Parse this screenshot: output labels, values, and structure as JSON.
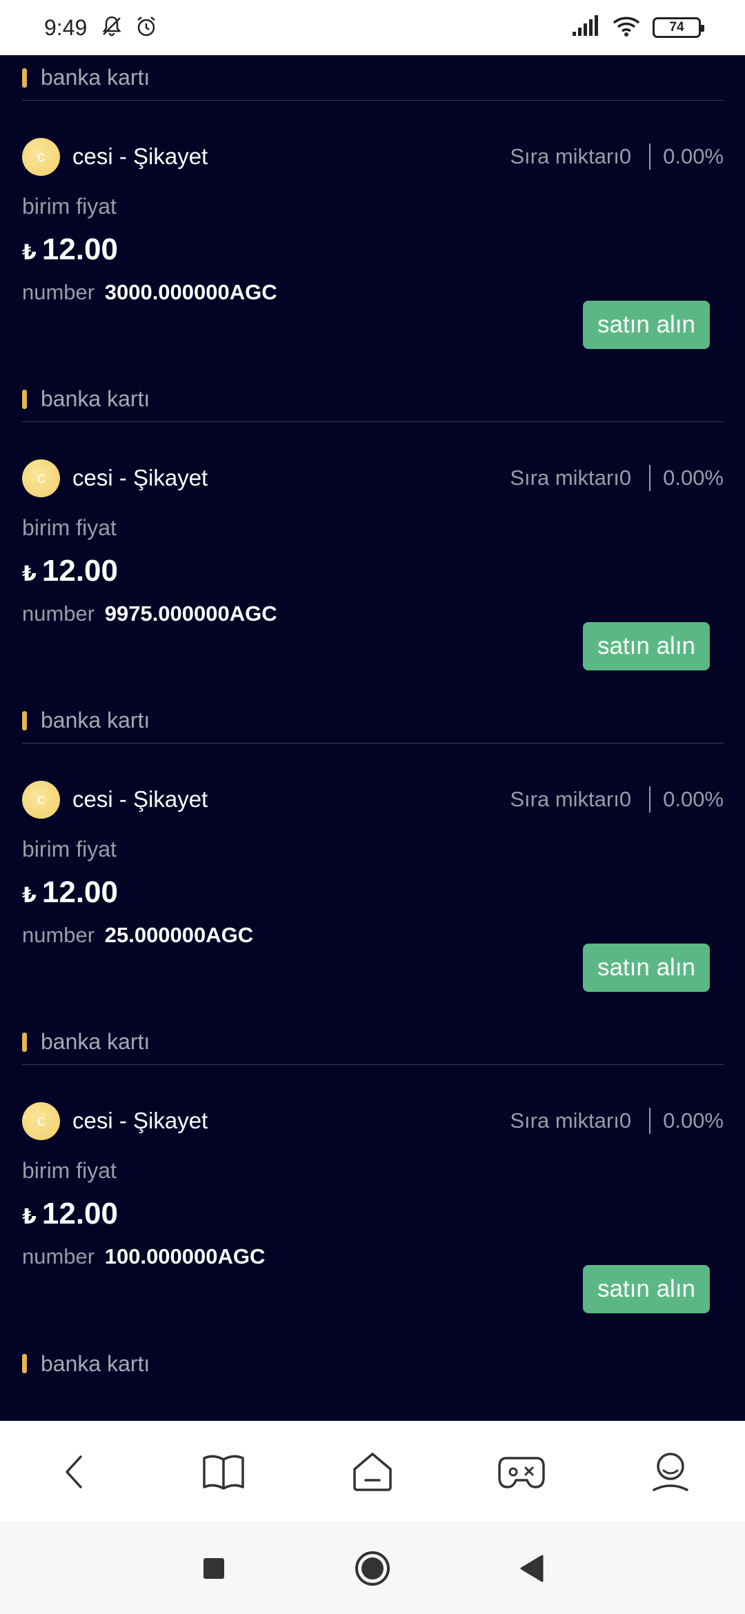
{
  "status_bar": {
    "time": "9:49",
    "battery": "74",
    "icons": [
      "mute-icon",
      "alarm-icon",
      "signal-icon",
      "wifi-icon",
      "battery-icon"
    ]
  },
  "colors": {
    "background": "#020325",
    "accent_bar": "#e5b550",
    "buy_button": "#5bb885"
  },
  "listings": [
    {
      "section": "banka kartı",
      "avatar_letter": "c",
      "merchant": "cesi - Şikayet",
      "queue_label": "Sıra miktarı0",
      "rate": "0.00%",
      "price_label": "birim fiyat",
      "currency": "₺",
      "price": "12.00",
      "qty_label": "number",
      "qty_value": "3000.000000AGC",
      "button": "satın alın"
    },
    {
      "section": "banka kartı",
      "avatar_letter": "c",
      "merchant": "cesi - Şikayet",
      "queue_label": "Sıra miktarı0",
      "rate": "0.00%",
      "price_label": "birim fiyat",
      "currency": "₺",
      "price": "12.00",
      "qty_label": "number",
      "qty_value": "9975.000000AGC",
      "button": "satın alın"
    },
    {
      "section": "banka kartı",
      "avatar_letter": "c",
      "merchant": "cesi - Şikayet",
      "queue_label": "Sıra miktarı0",
      "rate": "0.00%",
      "price_label": "birim fiyat",
      "currency": "₺",
      "price": "12.00",
      "qty_label": "number",
      "qty_value": "25.000000AGC",
      "button": "satın alın"
    },
    {
      "section": "banka kartı",
      "avatar_letter": "c",
      "merchant": "cesi - Şikayet",
      "queue_label": "Sıra miktarı0",
      "rate": "0.00%",
      "price_label": "birim fiyat",
      "currency": "₺",
      "price": "12.00",
      "qty_label": "number",
      "qty_value": "100.000000AGC",
      "button": "satın alın"
    }
  ],
  "trailing_section": "banka kartı",
  "bottom_nav": [
    "back-icon",
    "book-icon",
    "home-icon",
    "gamepad-icon",
    "profile-icon"
  ],
  "system_nav": [
    "recents-icon",
    "home-circle-icon",
    "back-triangle-icon"
  ]
}
